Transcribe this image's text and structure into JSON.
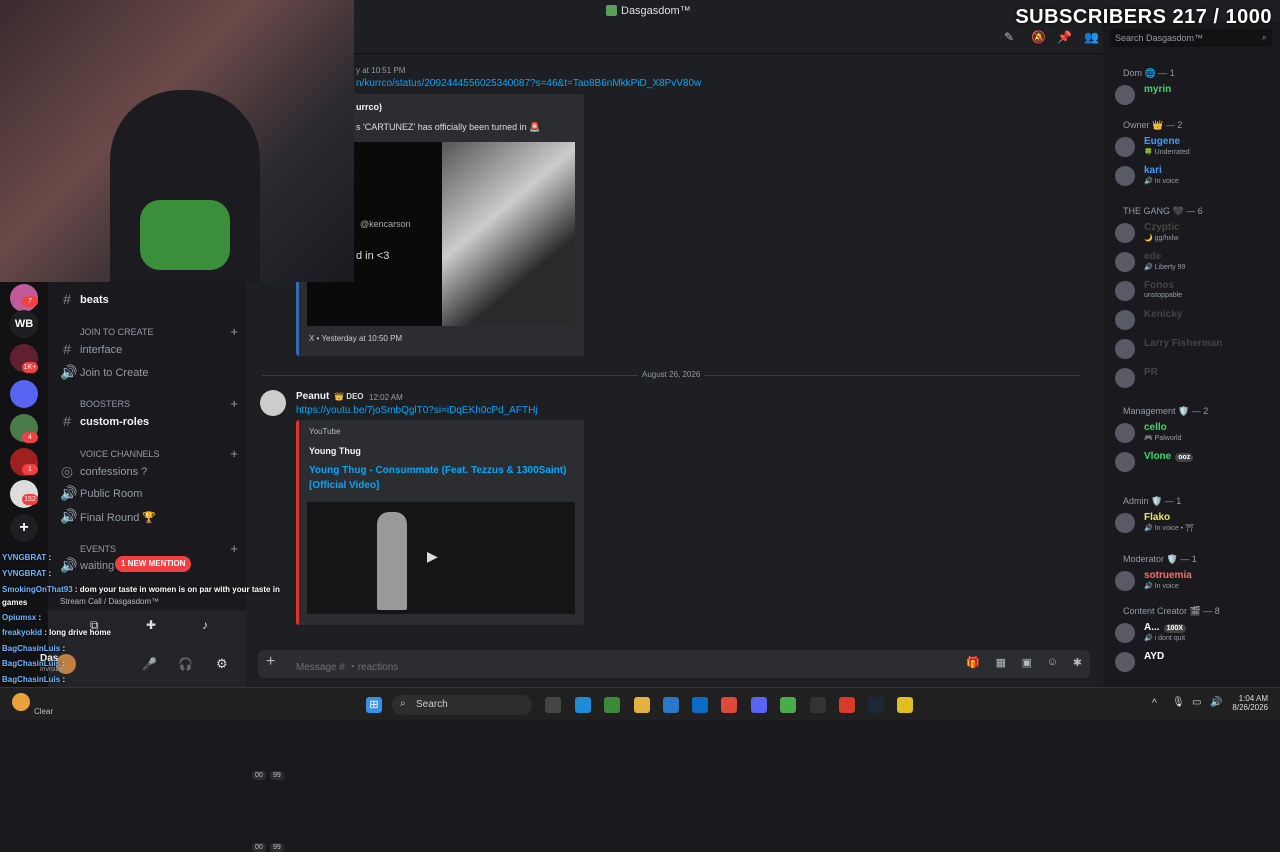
{
  "window": {
    "title": "Dasgasdom™"
  },
  "overlay": {
    "subscribers": "SUBSCRIBERS 217 / 1000"
  },
  "servers": {
    "wb_label": "WB",
    "badges": [
      "7",
      "1K+",
      "4",
      "1",
      "152"
    ],
    "add_icon": "+"
  },
  "channels": {
    "beats": "beats",
    "join_category": "JOIN TO CREATE",
    "interface": "interface",
    "join_to_create": "Join to Create",
    "boosters_category": "BOOSTERS",
    "custom_roles": "custom-roles",
    "voice_category": "VOICE CHANNELS",
    "confessions": "confessions ?",
    "public_room": "Public Room",
    "public_room_pills": [
      "00",
      "99"
    ],
    "final_round": "Final Round 🏆",
    "events_category": "EVENTS",
    "waiting": "waiting",
    "waiting_pills": [
      "00",
      "99"
    ],
    "new_mention": "1 NEW MENTION"
  },
  "userpanel": {
    "stream_call": "Stream Call / Dasgasdom™",
    "name": "Das",
    "status": "invisible"
  },
  "chat_overlay": [
    {
      "user": "YVNGBRAT",
      "text": ":"
    },
    {
      "user": "YVNGBRAT",
      "text": ":"
    },
    {
      "user": "SmokingOnThat93",
      "text": ": dom your taste in women is on par with your taste in"
    },
    {
      "user": "",
      "text": "games"
    },
    {
      "user": "Opiumsx",
      "text": ":"
    },
    {
      "user": "freakyokid",
      "text": ": long drive home"
    },
    {
      "user": "BagChasinLuis",
      "text": ":"
    },
    {
      "user": "BagChasinLuis",
      "text": ":"
    },
    {
      "user": "BagChasinLuis",
      "text": ":"
    },
    {
      "user": "BagChasinLuis",
      "text": ":"
    }
  ],
  "header": {
    "search_placeholder": "Search Dasgasdom™"
  },
  "messages": {
    "m1": {
      "time": "y at 10:51 PM",
      "link": "n/kurrco/status/2092444556025340087?s=46&t=Tao8B6nMkkPiD_X8PvV80w",
      "author": "urrco)",
      "text": "s 'CARTUNEZ' has officially been turned in 🚨",
      "img_handle": "@kencarson",
      "img_text": "d in <3",
      "footer": "X • Yesterday at 10:50 PM"
    },
    "date_divider": "August 26, 2026",
    "m2": {
      "author": "Peanut",
      "role": "DEO",
      "time": "12:02 AM",
      "link": "https://youtu.be/7joSmbQglT0?si=iDqEKh0cPd_AFTHj",
      "provider": "YouTube",
      "channel": "Young Thug",
      "title": "Young Thug - Consummate (Feat. Tezzus & 1300Saint) [Official Video]"
    }
  },
  "composer": {
    "placeholder": "Message # ・reactions"
  },
  "members": {
    "groups": [
      {
        "title": "Dom 🌐 — 1",
        "members": [
          {
            "name": "myrin",
            "status": "",
            "color": "#3ed66a"
          }
        ]
      },
      {
        "title": "Owner 👑 — 2",
        "members": [
          {
            "name": "Eugene",
            "status": "🍀 Underrated",
            "color": "#3b9eff"
          },
          {
            "name": "kari",
            "status": "🔊 In voice",
            "color": "#3b9eff"
          }
        ]
      },
      {
        "title": "THE GANG 🖤 — 6",
        "members": [
          {
            "name": "Czyptic",
            "status": "🌙 gg/hxlw",
            "color": "#444"
          },
          {
            "name": "ede",
            "status": "🔊 Liberty 99",
            "color": "#444"
          },
          {
            "name": "Fonos",
            "status": "unstoppable",
            "color": "#444"
          },
          {
            "name": "Kenicky",
            "status": "",
            "color": "#444"
          },
          {
            "name": "Larry Fisherman",
            "status": "",
            "color": "#444"
          },
          {
            "name": "PR",
            "status": "",
            "color": "#444"
          }
        ]
      },
      {
        "title": "Management 🛡️ — 2",
        "members": [
          {
            "name": "cello",
            "status": "🎮 Palworld",
            "color": "#3ed66a"
          },
          {
            "name": "Vlone",
            "status": "",
            "badge": "ooz",
            "color": "#3ed66a"
          }
        ]
      },
      {
        "title": "Admin 🛡️ — 1",
        "members": [
          {
            "name": "Flako",
            "status": "🔊 In voice • ⛩",
            "color": "#e8e84a"
          }
        ]
      },
      {
        "title": "Moderator 🛡️ — 1",
        "members": [
          {
            "name": "sotruemia",
            "status": "🔊 In voice",
            "color": "#ff6b6b"
          }
        ]
      },
      {
        "title": "Content Creator 🎬 — 8",
        "members": [
          {
            "name": "A...",
            "status": "🔊 i dont quit",
            "badge": "100X",
            "color": "#fff"
          },
          {
            "name": "AYD",
            "status": "",
            "color": "#fff"
          }
        ]
      }
    ]
  },
  "taskbar": {
    "search": "Search",
    "weather": "Clear",
    "time": "1:04 AM",
    "date": "8/26/2026"
  },
  "colors": {
    "accent": "#5865f2",
    "mention": "#f23f42",
    "link": "#00a8fc"
  }
}
